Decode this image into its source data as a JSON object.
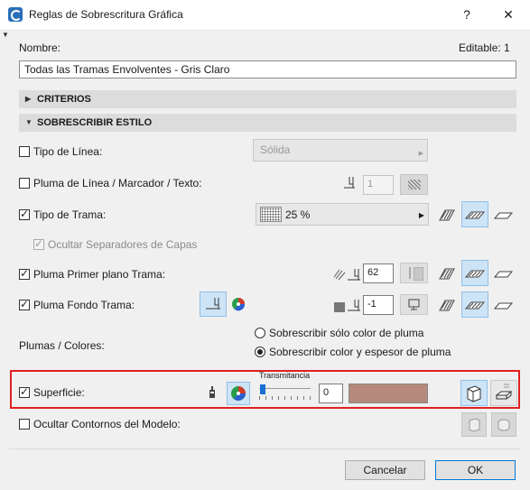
{
  "window": {
    "title": "Reglas de Sobrescritura Gráfica",
    "help": "?",
    "close": "✕"
  },
  "nombre": {
    "label": "Nombre:",
    "editable": "Editable: 1",
    "value": "Todas las Tramas Envolventes - Gris Claro"
  },
  "sections": {
    "criterios": "CRITERIOS",
    "sobrescribir": "SOBRESCRIBIR ESTILO"
  },
  "rows": {
    "tipo_linea": {
      "label": "Tipo de Línea:",
      "checked": false,
      "value": "Sólida"
    },
    "pluma_linea": {
      "label": "Pluma de Línea / Marcador / Texto:",
      "checked": false,
      "pen": "1"
    },
    "tipo_trama": {
      "label": "Tipo de Trama:",
      "checked": true,
      "value": "25 %"
    },
    "ocultar_sep": {
      "label": "Ocultar Separadores de Capas",
      "checked": true
    },
    "pluma_primer": {
      "label": "Pluma Primer plano Trama:",
      "checked": true,
      "pen": "62"
    },
    "pluma_fondo": {
      "label": "Pluma Fondo Trama:",
      "checked": true,
      "pen": "-1"
    }
  },
  "plumas": {
    "label": "Plumas / Colores:",
    "option1": "Sobrescribir sólo color de pluma",
    "option2": "Sobrescribir color y espesor de pluma",
    "selected": 2
  },
  "superficie": {
    "label": "Superficie:",
    "checked": true,
    "transmitancia_label": "Transmitancia",
    "transmitancia_value": "0",
    "color": "#b58a7c",
    "highlight_color": "#e0201f"
  },
  "ocultar_contornos": {
    "label": "Ocultar Contornos del Modelo:",
    "checked": false
  },
  "buttons": {
    "cancel": "Cancelar",
    "ok": "OK"
  }
}
